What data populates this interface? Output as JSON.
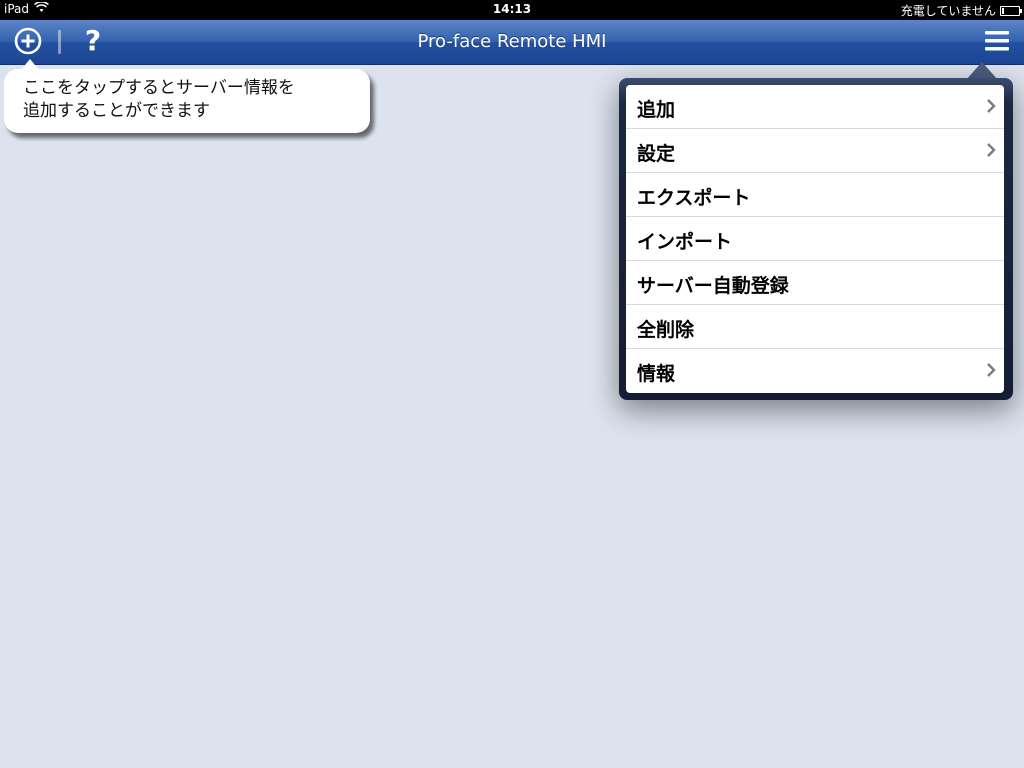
{
  "statusbar": {
    "device": "iPad",
    "time": "14:13",
    "charging": "充電していません"
  },
  "navbar": {
    "title": "Pro-face Remote HMI",
    "help_label": "?"
  },
  "tooltip": {
    "line1": "ここをタップするとサーバー情報を",
    "line2": "追加することができます"
  },
  "menu": {
    "items": [
      {
        "label": "追加",
        "has_chevron": true
      },
      {
        "label": "設定",
        "has_chevron": true
      },
      {
        "label": "エクスポート",
        "has_chevron": false
      },
      {
        "label": "インポート",
        "has_chevron": false
      },
      {
        "label": "サーバー自動登録",
        "has_chevron": false
      },
      {
        "label": "全削除",
        "has_chevron": false
      },
      {
        "label": "情報",
        "has_chevron": true
      }
    ]
  },
  "icons": {
    "add": "plus-circle-icon",
    "menu": "hamburger-menu-icon",
    "wifi": "wifi-icon",
    "battery": "battery-icon",
    "chevron": "chevron-right-icon"
  },
  "colors": {
    "navbar": "#2a56a3",
    "background": "#dce3ee",
    "popover": "#1c2741"
  }
}
